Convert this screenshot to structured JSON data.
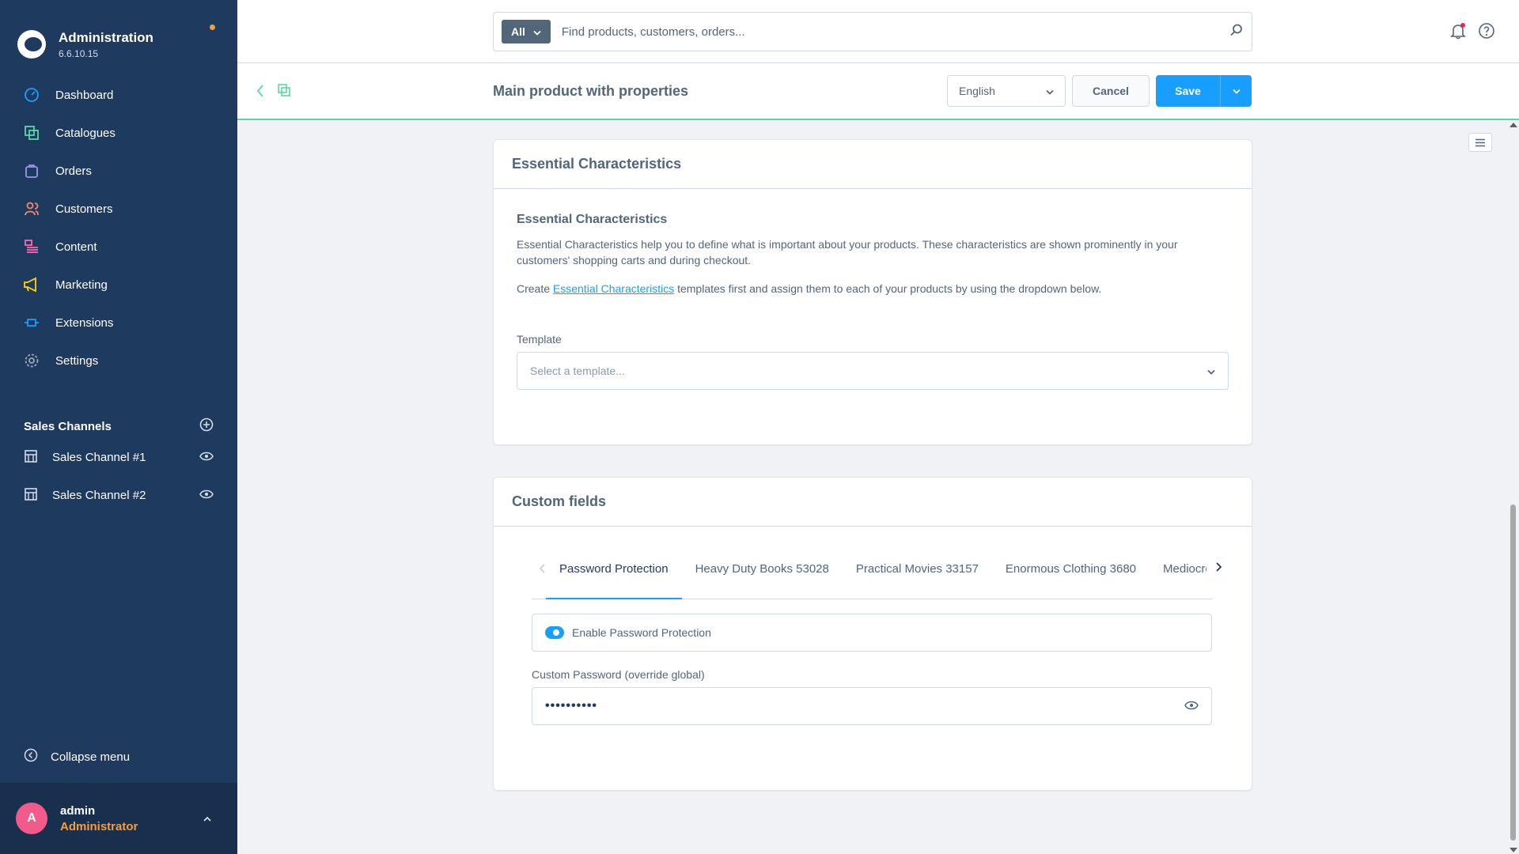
{
  "colors": {
    "sidebar": "#1f3a5f",
    "accent": "#189eff",
    "success_border": "#57d9a3",
    "user_role": "#f79d3b",
    "avatar": "#f25a8c"
  },
  "brand": {
    "title": "Administration",
    "version": "6.6.10.15"
  },
  "nav": [
    {
      "label": "Dashboard",
      "icon": "dashboard-icon",
      "color": "#189eff"
    },
    {
      "label": "Catalogues",
      "icon": "catalogue-icon",
      "color": "#57d9a3"
    },
    {
      "label": "Orders",
      "icon": "orders-icon",
      "color": "#a092f0"
    },
    {
      "label": "Customers",
      "icon": "customers-icon",
      "color": "#f88962"
    },
    {
      "label": "Content",
      "icon": "content-icon",
      "color": "#ff68b4"
    },
    {
      "label": "Marketing",
      "icon": "marketing-icon",
      "color": "#ffd700"
    },
    {
      "label": "Extensions",
      "icon": "extensions-icon",
      "color": "#189eff"
    },
    {
      "label": "Settings",
      "icon": "settings-icon",
      "color": "#9aa8b5"
    }
  ],
  "sales_channels": {
    "title": "Sales Channels",
    "items": [
      {
        "label": "Sales Channel #1"
      },
      {
        "label": "Sales Channel #2"
      }
    ]
  },
  "collapse_label": "Collapse menu",
  "user": {
    "initial": "A",
    "name": "admin",
    "role": "Administrator"
  },
  "search": {
    "type": "All",
    "placeholder": "Find products, customers, orders..."
  },
  "smartbar": {
    "title": "Main product with properties",
    "language": "English",
    "cancel": "Cancel",
    "save": "Save"
  },
  "essential": {
    "card_title": "Essential Characteristics",
    "heading": "Essential Characteristics",
    "desc": "Essential Characteristics help you to define what is important about your products. These characteristics are shown prominently in your customers' shopping carts and during checkout.",
    "create_prefix": "Create ",
    "create_link": "Essential Characteristics",
    "create_suffix": " templates first and assign them to each of your products by using the dropdown below.",
    "template_label": "Template",
    "template_placeholder": "Select a template..."
  },
  "custom_fields": {
    "card_title": "Custom fields",
    "tabs": [
      "Password Protection",
      "Heavy Duty Books 53028",
      "Practical Movies 33157",
      "Enormous Clothing 3680",
      "Mediocre Be"
    ],
    "toggle_label": "Enable Password Protection",
    "password_label": "Custom Password (override global)",
    "password_value": "••••••••••"
  }
}
